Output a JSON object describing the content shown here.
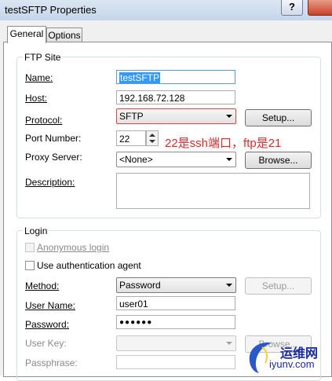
{
  "window": {
    "title": "testSFTP Properties",
    "help_glyph": "?"
  },
  "tabs": [
    {
      "label": "General"
    },
    {
      "label": "Options"
    }
  ],
  "ftp_site": {
    "group_label": "FTP Site",
    "name_label": "Name:",
    "name_value": "testSFTP",
    "host_label": "Host:",
    "host_value": "192.168.72.128",
    "protocol_label": "Protocol:",
    "protocol_value": "SFTP",
    "protocol_setup_label": "Setup...",
    "port_label": "Port Number:",
    "port_value": "22",
    "proxy_label": "Proxy Server:",
    "proxy_value": "<None>",
    "browse_label": "Browse...",
    "description_label": "Description:",
    "description_value": ""
  },
  "annotation": {
    "text": "22是ssh端口，ftp是21",
    "color": "#e02a2a"
  },
  "login": {
    "group_label": "Login",
    "anonymous_label": "Anonymous login",
    "auth_agent_label": "Use authentication agent",
    "method_label": "Method:",
    "method_value": "Password",
    "method_setup_label": "Setup...",
    "username_label": "User Name:",
    "username_value": "user01",
    "password_label": "Password:",
    "password_value": "●●●●●●",
    "userkey_label": "User Key:",
    "userkey_value": "",
    "browse_label": "Browse...",
    "passphrase_label": "Passphrase:",
    "passphrase_value": ""
  },
  "watermark": {
    "text_cn": "运维网",
    "text_en": "iyunv.com"
  }
}
